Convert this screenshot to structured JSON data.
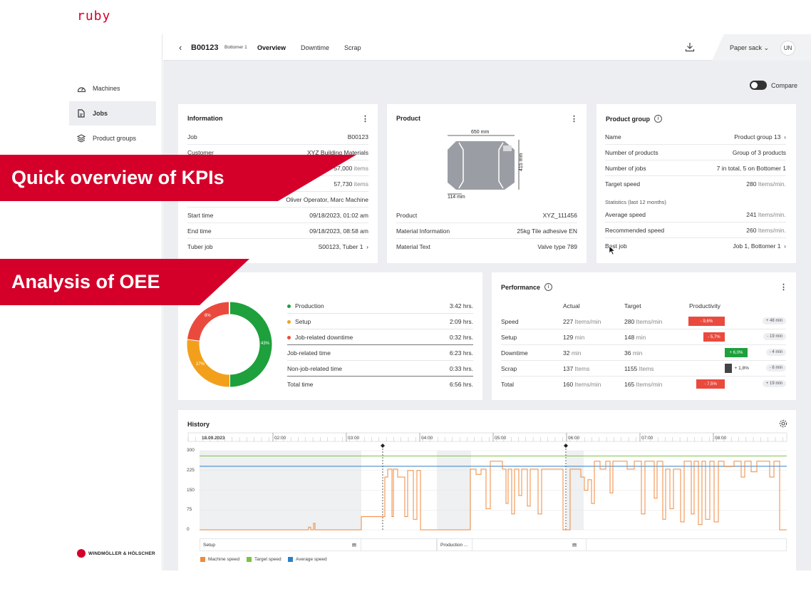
{
  "app": {
    "logo": "ruby",
    "brand_footer": "WINDMÖLLER & HÖLSCHER"
  },
  "sidebar": {
    "items": [
      {
        "label": "Machines",
        "icon": "gauge-icon"
      },
      {
        "label": "Jobs",
        "icon": "document-icon",
        "active": true
      },
      {
        "label": "Product groups",
        "icon": "layers-icon"
      }
    ]
  },
  "header": {
    "job_id": "B00123",
    "machine": "Bottomer 1",
    "tabs": [
      "Overview",
      "Downtime",
      "Scrap"
    ],
    "active_tab": "Overview",
    "product_type": "Paper sack",
    "user_initials": "UN"
  },
  "compare_label": "Compare",
  "banners": {
    "kpi": "Quick overview of KPIs",
    "oee": "Analysis of OEE"
  },
  "information": {
    "title": "Information",
    "rows": [
      {
        "label": "Job",
        "value": "B00123"
      },
      {
        "label": "Customer",
        "value": "XYZ Building Materials"
      },
      {
        "label": "",
        "value": "57,000",
        "unit": "items"
      },
      {
        "label": "",
        "value": "57,730",
        "unit": "items"
      },
      {
        "label": "",
        "value": "Oliver Operator, Marc Machine"
      },
      {
        "label": "Start time",
        "value": "09/18/2023, 01:02 am"
      },
      {
        "label": "End time",
        "value": "09/18/2023, 08:58 am"
      },
      {
        "label": "Tuber job",
        "value": "S00123, Tuber 1"
      }
    ]
  },
  "product": {
    "title": "Product",
    "dim_width": "650 mm",
    "dim_height": "415 mm",
    "dim_valve": "114 mm",
    "rows": [
      {
        "label": "Product",
        "value": "XYZ_111456"
      },
      {
        "label": "Material Information",
        "value": "25kg Tile adhesive EN"
      },
      {
        "label": "Material Text",
        "value": "Valve type 789"
      }
    ]
  },
  "product_group": {
    "title": "Product group",
    "rows": [
      {
        "label": "Name",
        "value": "Product group 13"
      },
      {
        "label": "Number of products",
        "value": "Group of 3 products"
      },
      {
        "label": "Number of jobs",
        "value": "7 in total, 5 on Bottomer 1"
      },
      {
        "label": "Target speed",
        "value": "280",
        "unit": "Items/min."
      }
    ],
    "stats_heading": "Statistics (last 12 months)",
    "stats": [
      {
        "label": "Average speed",
        "value": "241",
        "unit": "Items/min."
      },
      {
        "label": "Recommended speed",
        "value": "260",
        "unit": "Items/min."
      },
      {
        "label": "Best job",
        "value": "Job 1, Bottomer 1"
      }
    ]
  },
  "oee": {
    "donut": [
      {
        "name": "Production",
        "percent": 43,
        "label": "43%",
        "color": "#1ea03c"
      },
      {
        "name": "Setup",
        "percent": 27,
        "label": "27%",
        "color": "#f2a01c"
      },
      {
        "name": "Job-related downtime",
        "percent": 8,
        "label": "8%",
        "color": "#ea4a3e"
      }
    ],
    "rows": [
      {
        "label": "Production",
        "value": "3:42 hrs.",
        "color": "#1ea03c"
      },
      {
        "label": "Setup",
        "value": "2:09 hrs.",
        "color": "#f2a01c"
      },
      {
        "label": "Job-related downtime",
        "value": "0:32 hrs.",
        "color": "#ea4a3e"
      },
      {
        "label": "Job-related time",
        "value": "6:23 hrs."
      },
      {
        "label": "Non-job-related time",
        "value": "0:33 hrs."
      },
      {
        "label": "Total time",
        "value": "6:56 hrs."
      }
    ]
  },
  "performance": {
    "title": "Performance",
    "columns": [
      "Actual",
      "Target",
      "Productivity"
    ],
    "rows": [
      {
        "label": "Speed",
        "actual": "227",
        "actual_unit": "Items/min",
        "target": "280",
        "target_unit": "Items/min",
        "productivity": "- 9,6%",
        "productivity_pct": -9.6,
        "delta": "+ 48 min"
      },
      {
        "label": "Setup",
        "actual": "129",
        "actual_unit": "min",
        "target": "148",
        "target_unit": "min",
        "productivity": "- 5,7%",
        "productivity_pct": -5.7,
        "delta": "- 19 min"
      },
      {
        "label": "Downtime",
        "actual": "32",
        "actual_unit": "min",
        "target": "36",
        "target_unit": "min",
        "productivity": "+ 6,0%",
        "productivity_pct": 6.0,
        "delta": "- 4 min"
      },
      {
        "label": "Scrap",
        "actual": "137",
        "actual_unit": "Items",
        "target": "1155",
        "target_unit": "Items",
        "productivity": "+ 1,8%",
        "productivity_pct": 1.8,
        "delta": "- 6 min"
      },
      {
        "label": "Total",
        "actual": "160",
        "actual_unit": "Items/min",
        "target": "165",
        "target_unit": "Items/min",
        "productivity": "- 7,5%",
        "productivity_pct": -7.5,
        "delta": "+ 19 min"
      }
    ]
  },
  "history": {
    "title": "History",
    "date_label": "18.09.2023",
    "time_ticks": [
      "02:00",
      "03:00",
      "04:00",
      "05:00",
      "06:00",
      "07:00",
      "08:00"
    ],
    "y_ticks": [
      "300",
      "225",
      "150",
      "75",
      "0"
    ],
    "segments": [
      "Setup",
      "Production ..."
    ],
    "legend": [
      {
        "name": "Machine speed",
        "color": "#f08a3c"
      },
      {
        "name": "Target speed",
        "color": "#7cc242"
      },
      {
        "name": "Average speed",
        "color": "#2f7fc8"
      }
    ]
  },
  "chart_data": {
    "type": "line",
    "x": [
      "01:02",
      "02:00",
      "03:00",
      "04:00",
      "05:00",
      "06:00",
      "07:00",
      "08:00",
      "08:58"
    ],
    "ylim": [
      0,
      300
    ],
    "series": [
      {
        "name": "Target speed",
        "values": [
          280,
          280,
          280,
          280,
          280,
          280,
          280,
          280,
          280
        ]
      },
      {
        "name": "Average speed",
        "values": [
          241,
          241,
          241,
          241,
          241,
          241,
          241,
          241,
          241
        ]
      }
    ]
  }
}
